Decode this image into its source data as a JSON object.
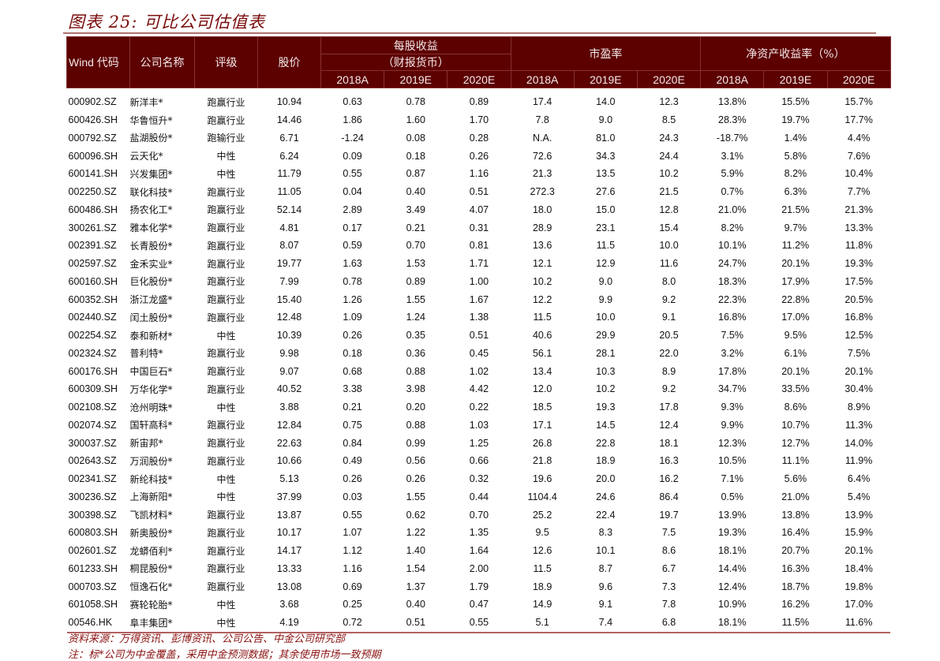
{
  "title": "图表 25:  可比公司估值表",
  "header": {
    "wind_code": "Wind 代码",
    "company_name": "公司名称",
    "rating": "评级",
    "price": "股价",
    "eps_group_line1": "每股收益",
    "eps_group_line2": "（财报货币）",
    "pe_group": "市盈率",
    "roe_group": "净资产收益率（%）",
    "years": [
      "2018A",
      "2019E",
      "2020E"
    ]
  },
  "rows": [
    [
      "000902.SZ",
      "新洋丰*",
      "跑赢行业",
      "10.94",
      "0.63",
      "0.78",
      "0.89",
      "17.4",
      "14.0",
      "12.3",
      "13.8%",
      "15.5%",
      "15.7%"
    ],
    [
      "600426.SH",
      "华鲁恒升*",
      "跑赢行业",
      "14.46",
      "1.86",
      "1.60",
      "1.70",
      "7.8",
      "9.0",
      "8.5",
      "28.3%",
      "19.7%",
      "17.7%"
    ],
    [
      "000792.SZ",
      "盐湖股份*",
      "跑输行业",
      "6.71",
      "-1.24",
      "0.08",
      "0.28",
      "N.A.",
      "81.0",
      "24.3",
      "-18.7%",
      "1.4%",
      "4.4%"
    ],
    [
      "600096.SH",
      "云天化*",
      "中性",
      "6.24",
      "0.09",
      "0.18",
      "0.26",
      "72.6",
      "34.3",
      "24.4",
      "3.1%",
      "5.8%",
      "7.6%"
    ],
    [
      "600141.SH",
      "兴发集团*",
      "中性",
      "11.79",
      "0.55",
      "0.87",
      "1.16",
      "21.3",
      "13.5",
      "10.2",
      "5.9%",
      "8.2%",
      "10.4%"
    ],
    [
      "002250.SZ",
      "联化科技*",
      "跑赢行业",
      "11.05",
      "0.04",
      "0.40",
      "0.51",
      "272.3",
      "27.6",
      "21.5",
      "0.7%",
      "6.3%",
      "7.7%"
    ],
    [
      "600486.SH",
      "扬农化工*",
      "跑赢行业",
      "52.14",
      "2.89",
      "3.49",
      "4.07",
      "18.0",
      "15.0",
      "12.8",
      "21.0%",
      "21.5%",
      "21.3%"
    ],
    [
      "300261.SZ",
      "雅本化学*",
      "跑赢行业",
      "4.81",
      "0.17",
      "0.21",
      "0.31",
      "28.9",
      "23.1",
      "15.4",
      "8.2%",
      "9.7%",
      "13.3%"
    ],
    [
      "002391.SZ",
      "长青股份*",
      "跑赢行业",
      "8.07",
      "0.59",
      "0.70",
      "0.81",
      "13.6",
      "11.5",
      "10.0",
      "10.1%",
      "11.2%",
      "11.8%"
    ],
    [
      "002597.SZ",
      "金禾实业*",
      "跑赢行业",
      "19.77",
      "1.63",
      "1.53",
      "1.71",
      "12.1",
      "12.9",
      "11.6",
      "24.7%",
      "20.1%",
      "19.3%"
    ],
    [
      "600160.SH",
      "巨化股份*",
      "跑赢行业",
      "7.99",
      "0.78",
      "0.89",
      "1.00",
      "10.2",
      "9.0",
      "8.0",
      "18.3%",
      "17.9%",
      "17.5%"
    ],
    [
      "600352.SH",
      "浙江龙盛*",
      "跑赢行业",
      "15.40",
      "1.26",
      "1.55",
      "1.67",
      "12.2",
      "9.9",
      "9.2",
      "22.3%",
      "22.8%",
      "20.5%"
    ],
    [
      "002440.SZ",
      "闰土股份*",
      "跑赢行业",
      "12.48",
      "1.09",
      "1.24",
      "1.38",
      "11.5",
      "10.0",
      "9.1",
      "16.8%",
      "17.0%",
      "16.8%"
    ],
    [
      "002254.SZ",
      "泰和新材*",
      "中性",
      "10.39",
      "0.26",
      "0.35",
      "0.51",
      "40.6",
      "29.9",
      "20.5",
      "7.5%",
      "9.5%",
      "12.5%"
    ],
    [
      "002324.SZ",
      "普利特*",
      "跑赢行业",
      "9.98",
      "0.18",
      "0.36",
      "0.45",
      "56.1",
      "28.1",
      "22.0",
      "3.2%",
      "6.1%",
      "7.5%"
    ],
    [
      "600176.SH",
      "中国巨石*",
      "跑赢行业",
      "9.07",
      "0.68",
      "0.88",
      "1.02",
      "13.4",
      "10.3",
      "8.9",
      "17.8%",
      "20.1%",
      "20.1%"
    ],
    [
      "600309.SH",
      "万华化学*",
      "跑赢行业",
      "40.52",
      "3.38",
      "3.98",
      "4.42",
      "12.0",
      "10.2",
      "9.2",
      "34.7%",
      "33.5%",
      "30.4%"
    ],
    [
      "002108.SZ",
      "沧州明珠*",
      "中性",
      "3.88",
      "0.21",
      "0.20",
      "0.22",
      "18.5",
      "19.3",
      "17.8",
      "9.3%",
      "8.6%",
      "8.9%"
    ],
    [
      "002074.SZ",
      "国轩高科*",
      "跑赢行业",
      "12.84",
      "0.75",
      "0.88",
      "1.03",
      "17.1",
      "14.5",
      "12.4",
      "9.9%",
      "10.7%",
      "11.3%"
    ],
    [
      "300037.SZ",
      "新宙邦*",
      "跑赢行业",
      "22.63",
      "0.84",
      "0.99",
      "1.25",
      "26.8",
      "22.8",
      "18.1",
      "12.3%",
      "12.7%",
      "14.0%"
    ],
    [
      "002643.SZ",
      "万润股份*",
      "跑赢行业",
      "10.66",
      "0.49",
      "0.56",
      "0.66",
      "21.8",
      "18.9",
      "16.3",
      "10.5%",
      "11.1%",
      "11.9%"
    ],
    [
      "002341.SZ",
      "新纶科技*",
      "中性",
      "5.13",
      "0.26",
      "0.26",
      "0.32",
      "19.6",
      "20.0",
      "16.2",
      "7.1%",
      "5.6%",
      "6.4%"
    ],
    [
      "300236.SZ",
      "上海新阳*",
      "中性",
      "37.99",
      "0.03",
      "1.55",
      "0.44",
      "1104.4",
      "24.6",
      "86.4",
      "0.5%",
      "21.0%",
      "5.4%"
    ],
    [
      "300398.SZ",
      "飞凯材料*",
      "跑赢行业",
      "13.87",
      "0.55",
      "0.62",
      "0.70",
      "25.2",
      "22.4",
      "19.7",
      "13.9%",
      "13.8%",
      "13.9%"
    ],
    [
      "600803.SH",
      "新奥股份*",
      "跑赢行业",
      "10.17",
      "1.07",
      "1.22",
      "1.35",
      "9.5",
      "8.3",
      "7.5",
      "19.3%",
      "16.4%",
      "15.9%"
    ],
    [
      "002601.SZ",
      "龙蟒佰利*",
      "跑赢行业",
      "14.17",
      "1.12",
      "1.40",
      "1.64",
      "12.6",
      "10.1",
      "8.6",
      "18.1%",
      "20.7%",
      "20.1%"
    ],
    [
      "601233.SH",
      "桐昆股份*",
      "跑赢行业",
      "13.33",
      "1.16",
      "1.54",
      "2.00",
      "11.5",
      "8.7",
      "6.7",
      "14.4%",
      "16.3%",
      "18.4%"
    ],
    [
      "000703.SZ",
      "恒逸石化*",
      "跑赢行业",
      "13.08",
      "0.69",
      "1.37",
      "1.79",
      "18.9",
      "9.6",
      "7.3",
      "12.4%",
      "18.7%",
      "19.8%"
    ],
    [
      "601058.SH",
      "赛轮轮胎*",
      "中性",
      "3.68",
      "0.25",
      "0.40",
      "0.47",
      "14.9",
      "9.1",
      "7.8",
      "10.9%",
      "16.2%",
      "17.0%"
    ],
    [
      "00546.HK",
      "阜丰集团*",
      "中性",
      "4.19",
      "0.72",
      "0.51",
      "0.55",
      "5.1",
      "7.4",
      "6.8",
      "18.1%",
      "11.5%",
      "11.6%"
    ]
  ],
  "footer": {
    "source": "资料来源：万得资讯、彭博资讯、公司公告、中金公司研究部",
    "note": "注：标*公司为中金覆盖，采用中金预测数据；其余使用市场一致预期"
  }
}
